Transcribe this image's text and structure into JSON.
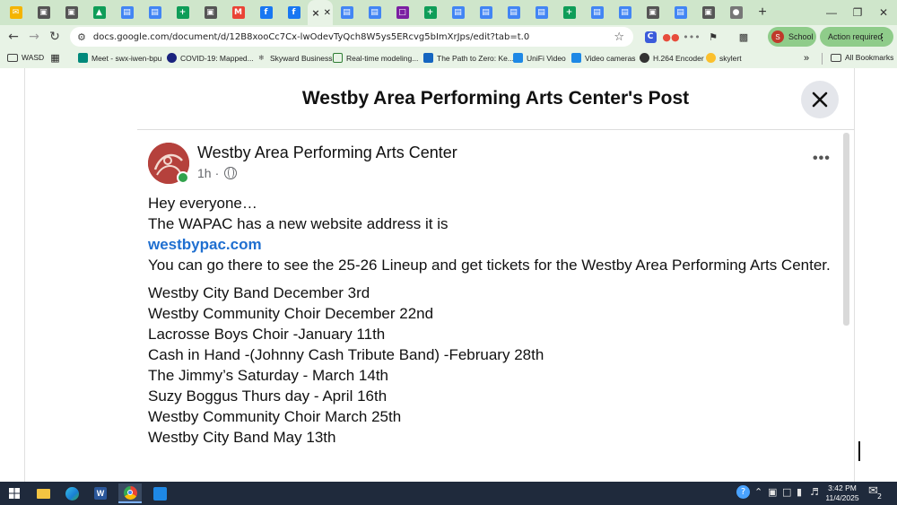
{
  "browser": {
    "url": "docs.google.com/document/d/12B8xooCc7Cx-lwOdevTyQch8W5ys5ERcvg5bImXrJps/edit?tab=t.0",
    "profile_label": "School",
    "profile_initial": "S",
    "action_required_label": "Action required",
    "accent_color": "#cfe6cb",
    "toolbar_color": "#e8f3e6"
  },
  "tabs": [
    {
      "icon": "mail-icon",
      "color": "#f4b400"
    },
    {
      "icon": "photo-icon",
      "color": "#555"
    },
    {
      "icon": "photo-icon",
      "color": "#555"
    },
    {
      "icon": "drive-icon",
      "color": "#0f9d58"
    },
    {
      "icon": "docs-icon",
      "color": "#4285f4"
    },
    {
      "icon": "docs-icon",
      "color": "#4285f4"
    },
    {
      "icon": "sheets-icon",
      "color": "#0f9d58"
    },
    {
      "icon": "photo-icon",
      "color": "#555"
    },
    {
      "icon": "gmail-icon",
      "color": "#ea4335"
    },
    {
      "icon": "facebook-icon",
      "color": "#1877f2"
    },
    {
      "icon": "facebook-icon",
      "color": "#1877f2"
    },
    {
      "icon": "active-tab-icon",
      "color": "#333",
      "active": true
    },
    {
      "icon": "docs-icon",
      "color": "#4285f4"
    },
    {
      "icon": "docs-icon",
      "color": "#4285f4"
    },
    {
      "icon": "slides-icon",
      "color": "#7b1fa2"
    },
    {
      "icon": "sheets-icon",
      "color": "#0f9d58"
    },
    {
      "icon": "docs-icon",
      "color": "#4285f4"
    },
    {
      "icon": "docs-icon",
      "color": "#4285f4"
    },
    {
      "icon": "docs-icon",
      "color": "#4285f4"
    },
    {
      "icon": "docs-icon",
      "color": "#4285f4"
    },
    {
      "icon": "sheets-icon",
      "color": "#0f9d58"
    },
    {
      "icon": "docs-icon",
      "color": "#4285f4"
    },
    {
      "icon": "docs-icon",
      "color": "#4285f4"
    },
    {
      "icon": "photo-icon",
      "color": "#555"
    },
    {
      "icon": "docs-icon",
      "color": "#4285f4"
    },
    {
      "icon": "photo-icon",
      "color": "#555"
    },
    {
      "icon": "globe-icon",
      "color": "#777"
    }
  ],
  "bookmarks": [
    {
      "label": "WASD",
      "icon": "folder-icon"
    },
    {
      "label": "Meet - swx-iwen-bpu",
      "icon": "meet-icon"
    },
    {
      "label": "COVID-19: Mapped...",
      "icon": "covid-icon"
    },
    {
      "label": "Skyward Business",
      "icon": "skyward-icon"
    },
    {
      "label": "Real-time modeling...",
      "icon": "model-icon"
    },
    {
      "label": "The Path to Zero: Ke...",
      "icon": "path-icon"
    },
    {
      "label": "UniFi Video",
      "icon": "unifi-icon"
    },
    {
      "label": "Video cameras",
      "icon": "camera-icon"
    },
    {
      "label": "H.264 Encoder",
      "icon": "encoder-icon"
    },
    {
      "label": "skylert",
      "icon": "skylert-icon"
    },
    {
      "label": "All Bookmarks",
      "icon": "folder-icon"
    }
  ],
  "post": {
    "dialog_title": "Westby Area Performing Arts Center's Post",
    "page_name": "Westby Area Performing Arts Center",
    "time": "1h",
    "time_separator": "·",
    "intro_lines": [
      "Hey everyone…",
      "The WAPAC has a new website address it is"
    ],
    "link": "westbypac.com",
    "after_link": "You can go there to see the 25-26 Lineup and get tickets for the Westby Area Performing Arts Center.",
    "lineup": [
      "Westby City Band December 3rd",
      "Westby Community Choir December 22nd",
      "Lacrosse Boys Choir -January 11th",
      "Cash in Hand -(Johnny Cash Tribute Band) -February 28th",
      "The Jimmy’s Saturday - March 14th",
      "Suzy Boggus Thurs day - April 16th",
      "Westby Community Choir March 25th",
      "Westby City Band May 13th"
    ]
  },
  "taskbar": {
    "time": "3:42 PM",
    "date": "11/4/2025",
    "notification_count": "2"
  }
}
